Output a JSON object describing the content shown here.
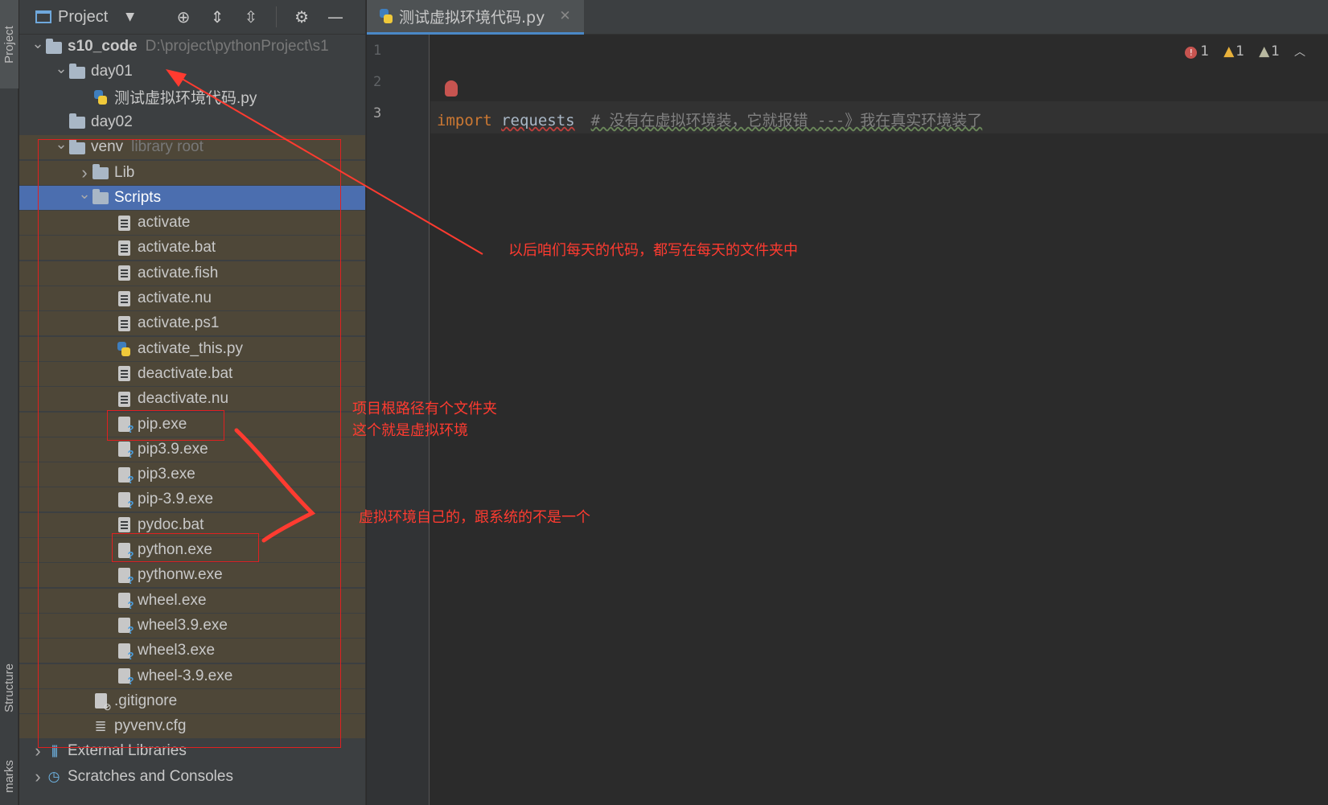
{
  "left_strip": {
    "project_tab": "Project",
    "structure_tab": "Structure",
    "bookmarks_tab": "marks"
  },
  "project_panel": {
    "title": "Project",
    "tree": [
      {
        "label": "s10_code",
        "hint": "D:\\project\\pythonProject\\s1",
        "type": "folder",
        "depth": 0,
        "expanded": true,
        "bold": true
      },
      {
        "label": "day01",
        "type": "folder",
        "depth": 1,
        "expanded": true
      },
      {
        "label": "测试虚拟环境代码.py",
        "type": "py",
        "depth": 2
      },
      {
        "label": "day02",
        "type": "folder",
        "depth": 1
      },
      {
        "label": "venv",
        "hint": "library root",
        "type": "folder",
        "depth": 1,
        "expanded": true
      },
      {
        "label": "Lib",
        "type": "folder",
        "depth": 2,
        "collapsed": true
      },
      {
        "label": "Scripts",
        "type": "folder",
        "depth": 2,
        "expanded": true,
        "selected": true
      },
      {
        "label": "activate",
        "type": "file",
        "depth": 3
      },
      {
        "label": "activate.bat",
        "type": "file",
        "depth": 3
      },
      {
        "label": "activate.fish",
        "type": "file",
        "depth": 3
      },
      {
        "label": "activate.nu",
        "type": "file",
        "depth": 3
      },
      {
        "label": "activate.ps1",
        "type": "file",
        "depth": 3
      },
      {
        "label": "activate_this.py",
        "type": "py",
        "depth": 3
      },
      {
        "label": "deactivate.bat",
        "type": "file",
        "depth": 3
      },
      {
        "label": "deactivate.nu",
        "type": "file",
        "depth": 3
      },
      {
        "label": "pip.exe",
        "type": "exe",
        "depth": 3
      },
      {
        "label": "pip3.9.exe",
        "type": "exe",
        "depth": 3
      },
      {
        "label": "pip3.exe",
        "type": "exe",
        "depth": 3
      },
      {
        "label": "pip-3.9.exe",
        "type": "exe",
        "depth": 3
      },
      {
        "label": "pydoc.bat",
        "type": "file",
        "depth": 3
      },
      {
        "label": "python.exe",
        "type": "exe",
        "depth": 3
      },
      {
        "label": "pythonw.exe",
        "type": "exe",
        "depth": 3
      },
      {
        "label": "wheel.exe",
        "type": "exe",
        "depth": 3
      },
      {
        "label": "wheel3.9.exe",
        "type": "exe",
        "depth": 3
      },
      {
        "label": "wheel3.exe",
        "type": "exe",
        "depth": 3
      },
      {
        "label": "wheel-3.9.exe",
        "type": "exe",
        "depth": 3
      },
      {
        "label": ".gitignore",
        "type": "git",
        "depth": 2
      },
      {
        "label": "pyvenv.cfg",
        "type": "cfg",
        "depth": 2
      },
      {
        "label": "External Libraries",
        "type": "lib",
        "depth": 0,
        "collapsed": true
      },
      {
        "label": "Scratches and Consoles",
        "type": "scr",
        "depth": 0,
        "collapsed": true
      }
    ]
  },
  "editor": {
    "tab_label": "测试虚拟环境代码.py",
    "line_numbers": [
      "1",
      "2",
      "3"
    ],
    "code": {
      "keyword": "import",
      "module": "requests",
      "comment": "# 没有在虚拟环境装，它就报错 ---》我在真实环境装了"
    },
    "inspections": {
      "errors": "1",
      "warnings": "1",
      "weak_warnings": "1"
    }
  },
  "annotations": {
    "daily_folder_note": "以后咱们每天的代码，都写在每天的文件夹中",
    "venv_note_line1": "项目根路径有个文件夹",
    "venv_note_line2": "这个就是虚拟环境",
    "own_env_note": "虚拟环境自己的，跟系统的不是一个"
  },
  "colors": {
    "annotation": "#ff3b30",
    "selection": "#4b6eaf",
    "accent_tab": "#4a88c7"
  }
}
